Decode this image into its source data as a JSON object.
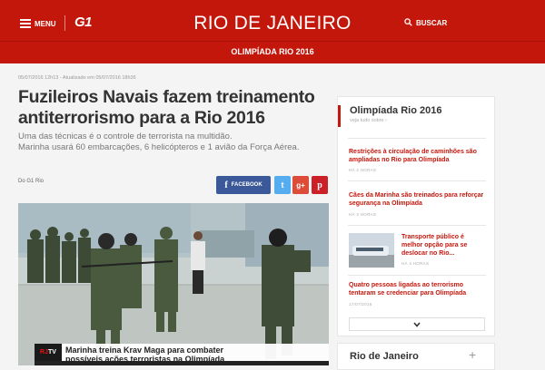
{
  "header": {
    "menu_label": "MENU",
    "logo": "G1",
    "site_title": "RIO DE JANEIRO",
    "subnav": "OLIMPÍADA RIO 2016",
    "search_placeholder": "BUSCAR"
  },
  "article": {
    "meta": "05/07/2016 12h13 - Atualizado em 05/07/2016 18h36",
    "headline": "Fuzileiros Navais fazem treinamento antiterrorismo para a Rio 2016",
    "subtitle_line1": "Uma das técnicas é o controle de terrorista na multidão.",
    "subtitle_line2": "Marinha usará 60 embarcações, 6 helicópteros e 1 avião da Força Aérea.",
    "byline": "Do G1 Rio",
    "share": {
      "facebook": "FACEBOOK",
      "twitter": "t",
      "gplus": "g+",
      "pinterest": "p"
    },
    "video_caption": {
      "logo_a": "RJ",
      "logo_b": "TV",
      "line1": "Marinha treina Krav Maga para combater",
      "line2": "possíveis ações  terroristas na Olimpíada"
    }
  },
  "sidebar": {
    "title": "Olimpíada Rio 2016",
    "subtitle": "veja tudo sobre ›",
    "items": [
      {
        "title": "Restrições à circulação de caminhões são ampliadas no Rio para Olimpíada",
        "time": "HÁ 2 HORAS"
      },
      {
        "title": "Cães da Marinha são treinados para reforçar segurança na Olimpíada",
        "time": "HÁ 3 HORAS"
      },
      {
        "title": "Transporte público é melhor opção para se deslocar no Rio...",
        "time": "HÁ 4 HORAS"
      },
      {
        "title": "Quatro pessoas ligadas ao terrorismo tentaram se credenciar para Olimpíada",
        "time": "17/07/2016"
      }
    ],
    "section2_title": "Rio de Janeiro",
    "section2_plus": "+"
  },
  "colors": {
    "brand_red": "#c4170c",
    "facebook": "#3b5998",
    "twitter": "#55acee",
    "gplus": "#dd4b39",
    "pinterest": "#cb2027"
  },
  "icons": {
    "menu": "hamburger-icon",
    "search": "search-icon",
    "more": "chevron-down-icon"
  }
}
